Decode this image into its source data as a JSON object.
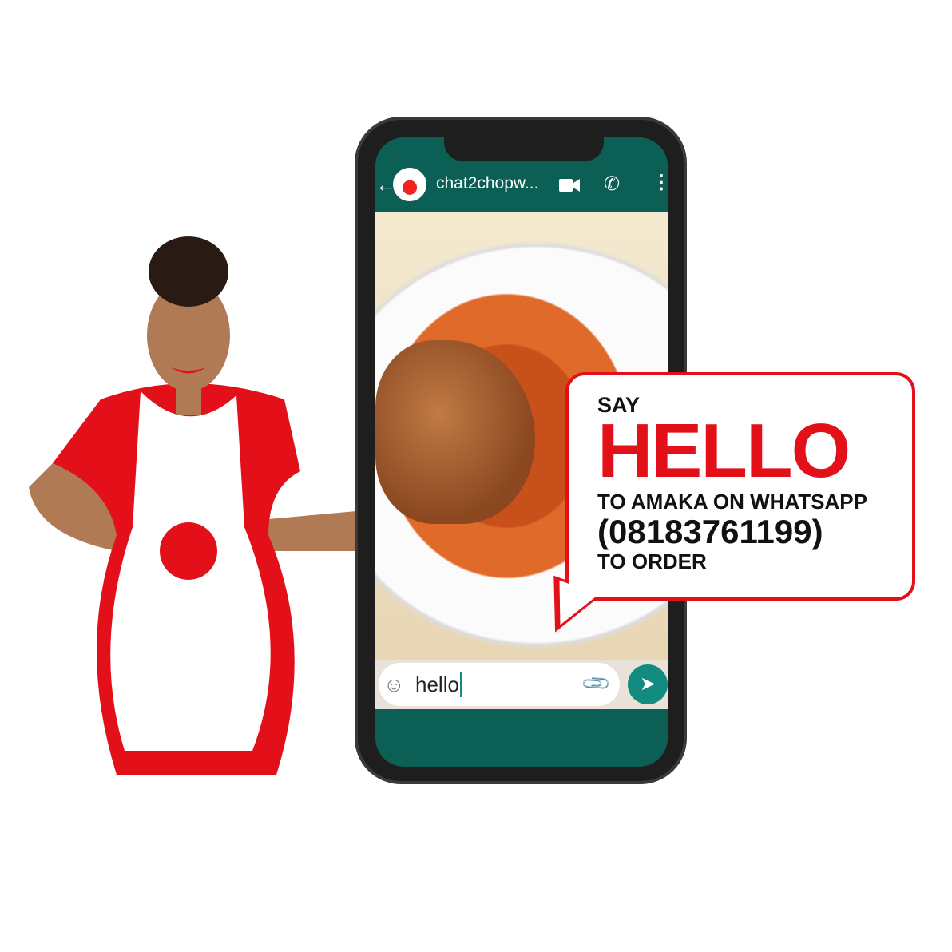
{
  "chat": {
    "title": "chat2chopw...",
    "icons": [
      "back-arrow-icon",
      "video-call-icon",
      "phone-icon",
      "more-vert-icon"
    ]
  },
  "composer": {
    "value": "hello",
    "icons": [
      "emoji-icon",
      "attachment-icon",
      "send-icon"
    ]
  },
  "promo": {
    "say": "SAY",
    "hello": "HELLO",
    "line1": "TO AMAKA ON WHATSAPP",
    "phone": "(08183761199)",
    "line2": "TO ORDER"
  },
  "colors": {
    "whatsapp": "#0b5f55",
    "send": "#128c7e",
    "brand_red": "#e3101a"
  }
}
